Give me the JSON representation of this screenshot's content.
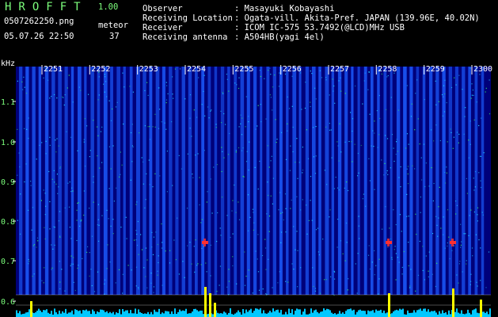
{
  "header": {
    "title": "HROFFT",
    "version": "1.00",
    "file_name": "0507262250.png",
    "kind_label": "meteor",
    "datetime": "05.07.26 22:50",
    "count": "37",
    "fields": [
      {
        "label": "Observer",
        "value": ": Masayuki Kobayashi"
      },
      {
        "label": "Receiving Location",
        "value": ": Ogata-vill. Akita-Pref. JAPAN (139.96E, 40.02N)"
      },
      {
        "label": "Receiver",
        "value": ": ICOM IC-575 53.7492(@LCD)MHz USB"
      },
      {
        "label": "Receiving antenna",
        "value": ": A504HB(yagi 4el)"
      }
    ]
  },
  "spectrogram": {
    "y_unit": "kHz",
    "y_ticks": [
      "1.1",
      "1.0",
      "0.9",
      "0.8",
      "0.7",
      "0.6"
    ],
    "time_labels": [
      "2251",
      "2252",
      "2253",
      "2254",
      "2255",
      "2256",
      "2257",
      "2258",
      "2259",
      "2300"
    ],
    "colors": {
      "background": "#00007a",
      "stripe": "#1c5cff",
      "noise_hi": "#20c8ff",
      "noise_green": "#2fe06a",
      "meteor": "#ff3030",
      "signal_bar": "#ffff00",
      "baseline": "#00c8ff",
      "text": "#ffffff",
      "axis_text": "#7cff7c"
    },
    "meteor_times": [
      "2254",
      "2258",
      "2259"
    ]
  }
}
